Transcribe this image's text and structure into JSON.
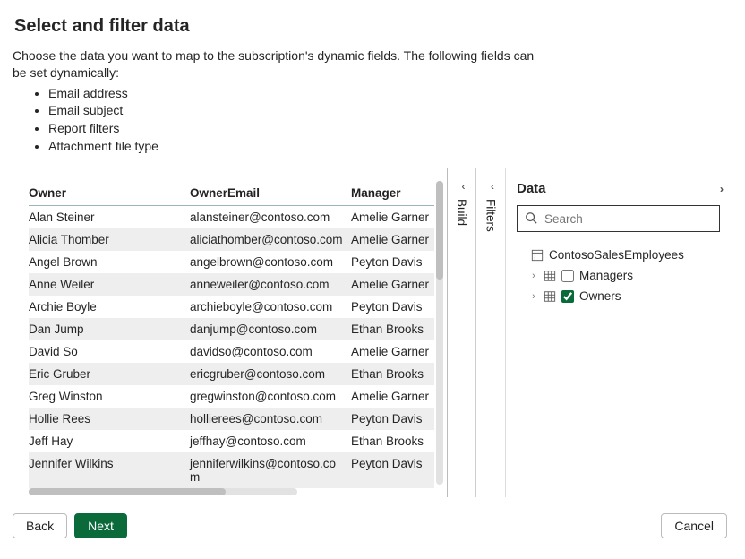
{
  "title": "Select and filter data",
  "intro_text": "Choose the data you want to map to the subscription's dynamic fields. The following fields can be set dynamically:",
  "intro_bullets": [
    "Email address",
    "Email subject",
    "Report filters",
    "Attachment file type"
  ],
  "table": {
    "columns": [
      "Owner",
      "OwnerEmail",
      "Manager"
    ],
    "rows": [
      [
        "Alan Steiner",
        "alansteiner@contoso.com",
        "Amelie Garner"
      ],
      [
        "Alicia Thomber",
        "aliciathomber@contoso.com",
        "Amelie Garner"
      ],
      [
        "Angel Brown",
        "angelbrown@contoso.com",
        "Peyton Davis"
      ],
      [
        "Anne Weiler",
        "anneweiler@contoso.com",
        "Amelie Garner"
      ],
      [
        "Archie Boyle",
        "archieboyle@contoso.com",
        "Peyton Davis"
      ],
      [
        "Dan Jump",
        "danjump@contoso.com",
        "Ethan Brooks"
      ],
      [
        "David So",
        "davidso@contoso.com",
        "Amelie Garner"
      ],
      [
        "Eric Gruber",
        "ericgruber@contoso.com",
        "Ethan Brooks"
      ],
      [
        "Greg Winston",
        "gregwinston@contoso.com",
        "Amelie Garner"
      ],
      [
        "Hollie Rees",
        "hollierees@contoso.com",
        "Peyton Davis"
      ],
      [
        "Jeff Hay",
        "jeffhay@contoso.com",
        "Ethan Brooks"
      ],
      [
        "Jennifer Wilkins",
        "jenniferwilkins@contoso.com",
        "Peyton Davis"
      ]
    ]
  },
  "vertical_tabs": {
    "build": "Build",
    "filters": "Filters"
  },
  "data_panel": {
    "title": "Data",
    "search_placeholder": "Search",
    "dataset": "ContosoSalesEmployees",
    "tables": [
      {
        "name": "Managers",
        "checked": false
      },
      {
        "name": "Owners",
        "checked": true
      }
    ]
  },
  "footer": {
    "back": "Back",
    "next": "Next",
    "cancel": "Cancel"
  }
}
